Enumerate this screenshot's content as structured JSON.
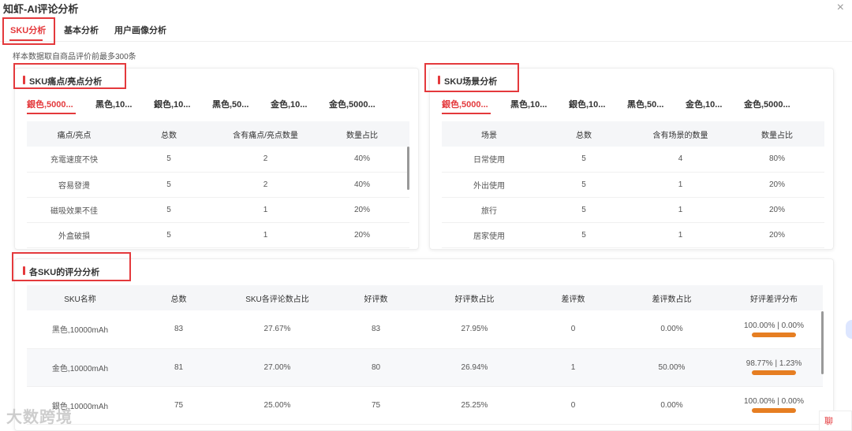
{
  "app": {
    "title": "知虾-AI评论分析",
    "close": "×"
  },
  "tabs": [
    {
      "label": "SKU分析",
      "active": true
    },
    {
      "label": "基本分析",
      "active": false
    },
    {
      "label": "用户画像分析",
      "active": false
    }
  ],
  "note": "样本数据取自商品评价前最多300条",
  "pain": {
    "title": "SKU痛点/亮点分析",
    "sku_tabs": [
      "銀色,5000...",
      "黑色,10...",
      "銀色,10...",
      "黑色,50...",
      "金色,10...",
      "金色,5000..."
    ],
    "headers": [
      "痛点/亮点",
      "总数",
      "含有痛点/亮点数量",
      "数量占比"
    ],
    "rows": [
      [
        "充電速度不快",
        "5",
        "2",
        "40%"
      ],
      [
        "容易發燙",
        "5",
        "2",
        "40%"
      ],
      [
        "磁吸效果不佳",
        "5",
        "1",
        "20%"
      ],
      [
        "外盒破損",
        "5",
        "1",
        "20%"
      ]
    ]
  },
  "scene": {
    "title": "SKU场景分析",
    "sku_tabs": [
      "銀色,5000...",
      "黑色,10...",
      "銀色,10...",
      "黑色,50...",
      "金色,10...",
      "金色,5000..."
    ],
    "headers": [
      "场景",
      "总数",
      "含有场景的数量",
      "数量占比"
    ],
    "rows": [
      [
        "日常使用",
        "5",
        "4",
        "80%"
      ],
      [
        "外出使用",
        "5",
        "1",
        "20%"
      ],
      [
        "旅行",
        "5",
        "1",
        "20%"
      ],
      [
        "居家使用",
        "5",
        "1",
        "20%"
      ]
    ]
  },
  "rating": {
    "title": "各SKU的评分分析",
    "headers": [
      "SKU名称",
      "总数",
      "SKU各评论数占比",
      "好评数",
      "好评数占比",
      "差评数",
      "差评数占比",
      "好评差评分布"
    ],
    "rows": [
      {
        "cells": [
          "黑色,10000mAh",
          "83",
          "27.67%",
          "83",
          "27.95%",
          "0",
          "0.00%"
        ],
        "dist": "100.00% | 0.00%",
        "good": 1.0
      },
      {
        "cells": [
          "金色,10000mAh",
          "81",
          "27.00%",
          "80",
          "26.94%",
          "1",
          "50.00%"
        ],
        "dist": "98.77% | 1.23%",
        "good": 0.9877
      },
      {
        "cells": [
          "銀色,10000mAh",
          "75",
          "25.00%",
          "75",
          "25.25%",
          "0",
          "0.00%"
        ],
        "dist": "100.00% | 0.00%",
        "good": 1.0
      }
    ]
  },
  "watermark": "大数跨境",
  "chat_label": "聊",
  "colors": {
    "accent": "#e4393c",
    "bar": "#e67e22"
  }
}
